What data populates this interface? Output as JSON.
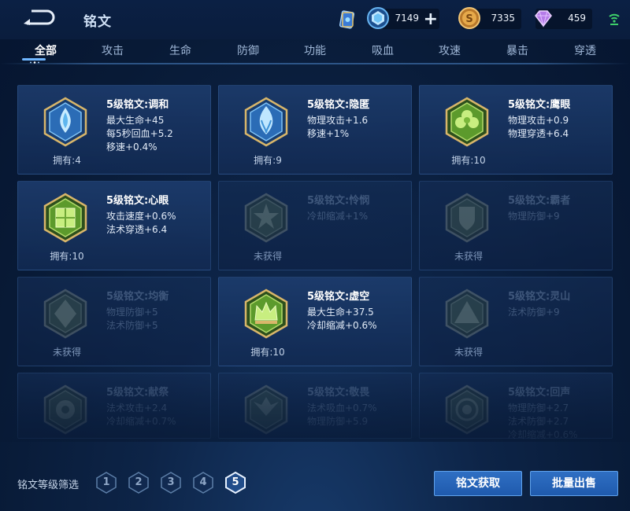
{
  "header": {
    "title": "铭文",
    "currencies": [
      {
        "name": "diamond",
        "value": "7149",
        "has_plus": true
      },
      {
        "name": "gold-coin",
        "value": "7335",
        "has_plus": false
      },
      {
        "name": "gem",
        "value": "459",
        "has_plus": false
      }
    ]
  },
  "tabs": [
    "全部",
    "攻击",
    "生命",
    "防御",
    "功能",
    "吸血",
    "攻速",
    "暴击",
    "穿透"
  ],
  "active_tab": 0,
  "runes": [
    {
      "name": "5级铭文:调和",
      "stats": [
        "最大生命+45",
        "每5秒回血+5.2",
        "移速+0.4%"
      ],
      "owned": "拥有:4",
      "locked": false,
      "color": "blue",
      "symbol": "drop"
    },
    {
      "name": "5级铭文:隐匿",
      "stats": [
        "物理攻击+1.6",
        "移速+1%"
      ],
      "owned": "拥有:9",
      "locked": false,
      "color": "blue",
      "symbol": "flame"
    },
    {
      "name": "5级铭文:鹰眼",
      "stats": [
        "物理攻击+0.9",
        "物理穿透+6.4"
      ],
      "owned": "拥有:10",
      "locked": false,
      "color": "green",
      "symbol": "clover"
    },
    {
      "name": "5级铭文:心眼",
      "stats": [
        "攻击速度+0.6%",
        "法术穿透+6.4"
      ],
      "owned": "拥有:10",
      "locked": false,
      "color": "green",
      "symbol": "book"
    },
    {
      "name": "5级铭文:怜悯",
      "stats": [
        "冷却缩减+1%"
      ],
      "owned": "未获得",
      "locked": true,
      "color": "green",
      "symbol": "star"
    },
    {
      "name": "5级铭文:霸者",
      "stats": [
        "物理防御+9"
      ],
      "owned": "未获得",
      "locked": true,
      "color": "green",
      "symbol": "shield"
    },
    {
      "name": "5级铭文:均衡",
      "stats": [
        "物理防御+5",
        "法术防御+5"
      ],
      "owned": "未获得",
      "locked": true,
      "color": "green",
      "symbol": "diamond"
    },
    {
      "name": "5级铭文:虚空",
      "stats": [
        "最大生命+37.5",
        "冷却缩减+0.6%"
      ],
      "owned": "拥有:10",
      "locked": false,
      "color": "green",
      "symbol": "crown"
    },
    {
      "name": "5级铭文:灵山",
      "stats": [
        "法术防御+9"
      ],
      "owned": "未获得",
      "locked": true,
      "color": "green",
      "symbol": "mountain"
    },
    {
      "name": "5级铭文:献祭",
      "stats": [
        "法术攻击+2.4",
        "冷却缩减+0.7%"
      ],
      "owned": "未获得",
      "locked": true,
      "color": "green",
      "symbol": "flower"
    },
    {
      "name": "5级铭文:敬畏",
      "stats": [
        "法术吸血+0.7%",
        "物理防御+5.9"
      ],
      "owned": "未获得",
      "locked": true,
      "color": "green",
      "symbol": "wings"
    },
    {
      "name": "5级铭文:回声",
      "stats": [
        "物理防御+2.7",
        "法术防御+2.7",
        "冷却缩减+0.6%"
      ],
      "owned": "未获得",
      "locked": true,
      "color": "green",
      "symbol": "orb"
    }
  ],
  "footer": {
    "filter_label": "铭文等级筛选",
    "levels": [
      "1",
      "2",
      "3",
      "4",
      "5"
    ],
    "active_level": 4,
    "get_button": "铭文获取",
    "sell_button": "批量出售"
  },
  "colors": {
    "accent": "#2f6fc3",
    "tab_active": "#6fb6ff",
    "blue_rune": "#4ea7e6",
    "green_rune": "#78b83a",
    "gold_frame": "#d8b66a"
  }
}
